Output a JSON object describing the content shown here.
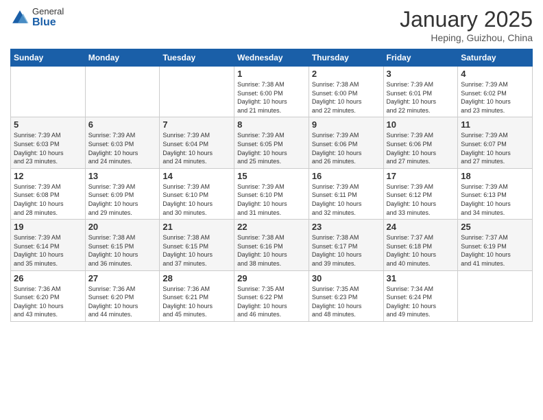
{
  "header": {
    "logo_general": "General",
    "logo_blue": "Blue",
    "title": "January 2025",
    "subtitle": "Heping, Guizhou, China"
  },
  "calendar": {
    "days_of_week": [
      "Sunday",
      "Monday",
      "Tuesday",
      "Wednesday",
      "Thursday",
      "Friday",
      "Saturday"
    ],
    "weeks": [
      [
        {
          "day": "",
          "info": ""
        },
        {
          "day": "",
          "info": ""
        },
        {
          "day": "",
          "info": ""
        },
        {
          "day": "1",
          "info": "Sunrise: 7:38 AM\nSunset: 6:00 PM\nDaylight: 10 hours\nand 21 minutes."
        },
        {
          "day": "2",
          "info": "Sunrise: 7:38 AM\nSunset: 6:00 PM\nDaylight: 10 hours\nand 22 minutes."
        },
        {
          "day": "3",
          "info": "Sunrise: 7:39 AM\nSunset: 6:01 PM\nDaylight: 10 hours\nand 22 minutes."
        },
        {
          "day": "4",
          "info": "Sunrise: 7:39 AM\nSunset: 6:02 PM\nDaylight: 10 hours\nand 23 minutes."
        }
      ],
      [
        {
          "day": "5",
          "info": "Sunrise: 7:39 AM\nSunset: 6:03 PM\nDaylight: 10 hours\nand 23 minutes."
        },
        {
          "day": "6",
          "info": "Sunrise: 7:39 AM\nSunset: 6:03 PM\nDaylight: 10 hours\nand 24 minutes."
        },
        {
          "day": "7",
          "info": "Sunrise: 7:39 AM\nSunset: 6:04 PM\nDaylight: 10 hours\nand 24 minutes."
        },
        {
          "day": "8",
          "info": "Sunrise: 7:39 AM\nSunset: 6:05 PM\nDaylight: 10 hours\nand 25 minutes."
        },
        {
          "day": "9",
          "info": "Sunrise: 7:39 AM\nSunset: 6:06 PM\nDaylight: 10 hours\nand 26 minutes."
        },
        {
          "day": "10",
          "info": "Sunrise: 7:39 AM\nSunset: 6:06 PM\nDaylight: 10 hours\nand 27 minutes."
        },
        {
          "day": "11",
          "info": "Sunrise: 7:39 AM\nSunset: 6:07 PM\nDaylight: 10 hours\nand 27 minutes."
        }
      ],
      [
        {
          "day": "12",
          "info": "Sunrise: 7:39 AM\nSunset: 6:08 PM\nDaylight: 10 hours\nand 28 minutes."
        },
        {
          "day": "13",
          "info": "Sunrise: 7:39 AM\nSunset: 6:09 PM\nDaylight: 10 hours\nand 29 minutes."
        },
        {
          "day": "14",
          "info": "Sunrise: 7:39 AM\nSunset: 6:10 PM\nDaylight: 10 hours\nand 30 minutes."
        },
        {
          "day": "15",
          "info": "Sunrise: 7:39 AM\nSunset: 6:10 PM\nDaylight: 10 hours\nand 31 minutes."
        },
        {
          "day": "16",
          "info": "Sunrise: 7:39 AM\nSunset: 6:11 PM\nDaylight: 10 hours\nand 32 minutes."
        },
        {
          "day": "17",
          "info": "Sunrise: 7:39 AM\nSunset: 6:12 PM\nDaylight: 10 hours\nand 33 minutes."
        },
        {
          "day": "18",
          "info": "Sunrise: 7:39 AM\nSunset: 6:13 PM\nDaylight: 10 hours\nand 34 minutes."
        }
      ],
      [
        {
          "day": "19",
          "info": "Sunrise: 7:39 AM\nSunset: 6:14 PM\nDaylight: 10 hours\nand 35 minutes."
        },
        {
          "day": "20",
          "info": "Sunrise: 7:38 AM\nSunset: 6:15 PM\nDaylight: 10 hours\nand 36 minutes."
        },
        {
          "day": "21",
          "info": "Sunrise: 7:38 AM\nSunset: 6:15 PM\nDaylight: 10 hours\nand 37 minutes."
        },
        {
          "day": "22",
          "info": "Sunrise: 7:38 AM\nSunset: 6:16 PM\nDaylight: 10 hours\nand 38 minutes."
        },
        {
          "day": "23",
          "info": "Sunrise: 7:38 AM\nSunset: 6:17 PM\nDaylight: 10 hours\nand 39 minutes."
        },
        {
          "day": "24",
          "info": "Sunrise: 7:37 AM\nSunset: 6:18 PM\nDaylight: 10 hours\nand 40 minutes."
        },
        {
          "day": "25",
          "info": "Sunrise: 7:37 AM\nSunset: 6:19 PM\nDaylight: 10 hours\nand 41 minutes."
        }
      ],
      [
        {
          "day": "26",
          "info": "Sunrise: 7:36 AM\nSunset: 6:20 PM\nDaylight: 10 hours\nand 43 minutes."
        },
        {
          "day": "27",
          "info": "Sunrise: 7:36 AM\nSunset: 6:20 PM\nDaylight: 10 hours\nand 44 minutes."
        },
        {
          "day": "28",
          "info": "Sunrise: 7:36 AM\nSunset: 6:21 PM\nDaylight: 10 hours\nand 45 minutes."
        },
        {
          "day": "29",
          "info": "Sunrise: 7:35 AM\nSunset: 6:22 PM\nDaylight: 10 hours\nand 46 minutes."
        },
        {
          "day": "30",
          "info": "Sunrise: 7:35 AM\nSunset: 6:23 PM\nDaylight: 10 hours\nand 48 minutes."
        },
        {
          "day": "31",
          "info": "Sunrise: 7:34 AM\nSunset: 6:24 PM\nDaylight: 10 hours\nand 49 minutes."
        },
        {
          "day": "",
          "info": ""
        }
      ]
    ]
  }
}
